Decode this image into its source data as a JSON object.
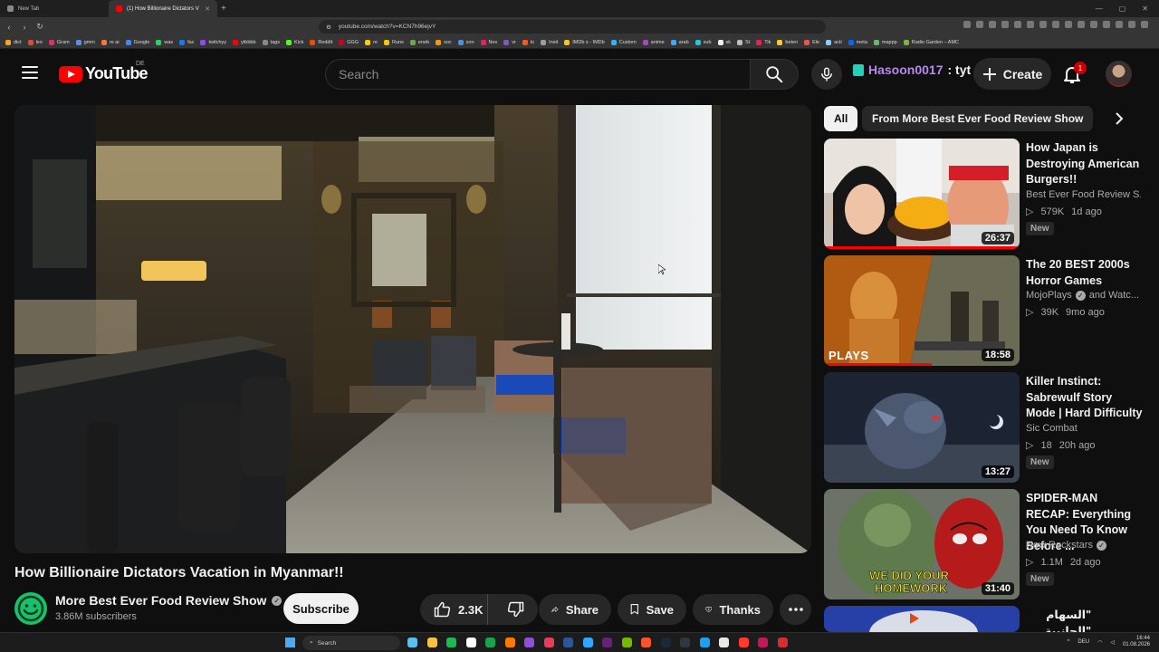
{
  "browser": {
    "tabs": [
      {
        "title": "New Tab"
      },
      {
        "title": "(1) How Billionaire Dictators V"
      }
    ],
    "url": "youtube.com/watch?v=KCN7h96ejvY",
    "bookmarks": [
      "dict",
      "leo",
      "Gram",
      "gmm",
      "re ai",
      "Google",
      "was",
      "fac",
      "twitchyy",
      "ytbbbb",
      "tags",
      "Kick",
      "Reddit",
      "GGG",
      "re",
      "Runs",
      "eneb",
      "soc",
      "zon",
      "Nex",
      "vr",
      "tc",
      "Insit",
      "IMDb s - IMDb",
      "Custom",
      "anime",
      "arab",
      "sub",
      "sk",
      "St",
      "Tik",
      "beten",
      "Ele",
      "acti",
      "meta",
      "mappp",
      "Radio Garden – AMC"
    ],
    "bookmark_colors": [
      "#f5a623",
      "#e04a3a",
      "#e1306c",
      "#5a8dee",
      "#ff7043",
      "#4285f4",
      "#25d366",
      "#1877f2",
      "#9146ff",
      "#ff0000",
      "#888888",
      "#53fc18",
      "#ff4500",
      "#d0021b",
      "#ffcc00",
      "#f6c400",
      "#6aa84f",
      "#ff9800",
      "#4a90e2",
      "#e91e63",
      "#7e57c2",
      "#ff5722",
      "#9e9e9e",
      "#f5c518",
      "#29b6f6",
      "#ab47bc",
      "#42a5f5",
      "#26c6da",
      "#eeeeee",
      "#bdbdbd",
      "#ee1d52",
      "#ffca28",
      "#ef5350",
      "#90caf9",
      "#0866ff",
      "#66bb6a",
      "#7cb342"
    ]
  },
  "youtube": {
    "logo_text": "YouTube",
    "country": "DE",
    "search_placeholder": "Search",
    "user_tag_name": "Hasoon0017",
    "user_tag_suffix": ": tyt",
    "create_label": "Create",
    "notif_count": "1"
  },
  "video": {
    "title": "How Billionaire Dictators Vacation in Myanmar!!",
    "channel": "More Best Ever Food Review Show",
    "subscribers": "3.86M subscribers",
    "subscribe_label": "Subscribe",
    "likes": "2.3K",
    "share_label": "Share",
    "save_label": "Save",
    "thanks_label": "Thanks"
  },
  "chips": {
    "all": "All",
    "channel": "From More Best Ever Food Review Show"
  },
  "recommendations": [
    {
      "title": "How Japan is Destroying American Burgers!!",
      "channel": "Best Ever Food Review S...",
      "verified": false,
      "views": "579K",
      "age": "1d ago",
      "badge": "New",
      "duration": "26:37",
      "progress": 0.99
    },
    {
      "title": "The 20 BEST 2000s Horror Games",
      "channel": "MojoPlays",
      "channel_extra": "and Watc...",
      "verified": true,
      "views": "39K",
      "age": "9mo ago",
      "badge": "",
      "duration": "18:58",
      "progress": 0.55,
      "thumb_text": "PLAYS"
    },
    {
      "title": "Killer Instinct: Sabrewulf Story Mode | Hard Difficulty",
      "channel": "Sic Combat",
      "verified": false,
      "views": "18",
      "age": "20h ago",
      "badge": "New",
      "duration": "13:27",
      "progress": 0
    },
    {
      "title": "SPIDER-MAN RECAP: Everything You Need To Know Before ...",
      "channel": "New Rockstars",
      "verified": true,
      "views": "1.1M",
      "age": "2d ago",
      "badge": "New",
      "duration": "31:40",
      "progress": 0,
      "thumb_text_1": "WE DID YOUR",
      "thumb_text_2": "HOMEWORK"
    },
    {
      "title": "\"السهام \"الجانبية",
      "channel": "",
      "verified": false,
      "views": "",
      "age": "",
      "badge": "",
      "duration": "",
      "progress": 0
    }
  ],
  "taskbar": {
    "search_label": "Search",
    "lang": "DEU",
    "time": "16:44",
    "date": "01.08.2026",
    "app_colors": [
      "#5bc0eb",
      "#f6c343",
      "#1db954",
      "#ffffff",
      "#1aa34a",
      "#ff7a00",
      "#8f4fd6",
      "#eb3b5a",
      "#2b5797",
      "#31a8ff",
      "#68217a",
      "#76b900",
      "#fb542b",
      "#1b2838",
      "#2f3640",
      "#1da1f2",
      "#e9e9e9",
      "#ff3b30",
      "#c2185b",
      "#d32f2f"
    ]
  },
  "colors": {
    "brand_red": "#ff0000",
    "background": "#0f0f0f",
    "surface": "#272727",
    "user_tag": "#b787f2"
  }
}
